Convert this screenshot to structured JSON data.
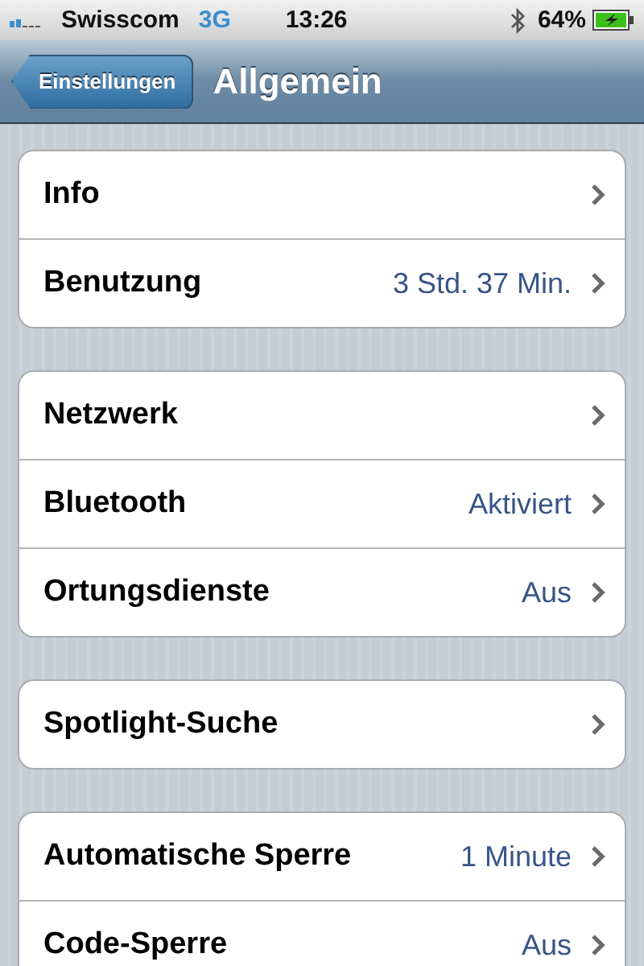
{
  "status_bar": {
    "carrier": "Swisscom",
    "network": "3G",
    "time": "13:26",
    "battery": "64%"
  },
  "nav_bar": {
    "back_button": "Einstellungen",
    "title": "Allgemein"
  },
  "groups": [
    {
      "rows": [
        {
          "label": "Info"
        },
        {
          "label": "Benutzung",
          "value": "3 Std. 37 Min."
        }
      ]
    },
    {
      "rows": [
        {
          "label": "Netzwerk"
        },
        {
          "label": "Bluetooth",
          "value": "Aktiviert"
        },
        {
          "label": "Ortungsdienste",
          "value": "Aus"
        }
      ]
    },
    {
      "rows": [
        {
          "label": "Spotlight-Suche"
        }
      ]
    },
    {
      "rows": [
        {
          "label": "Automatische Sperre",
          "value": "1 Minute"
        },
        {
          "label": "Code-Sperre",
          "value": "Aus"
        }
      ]
    }
  ]
}
